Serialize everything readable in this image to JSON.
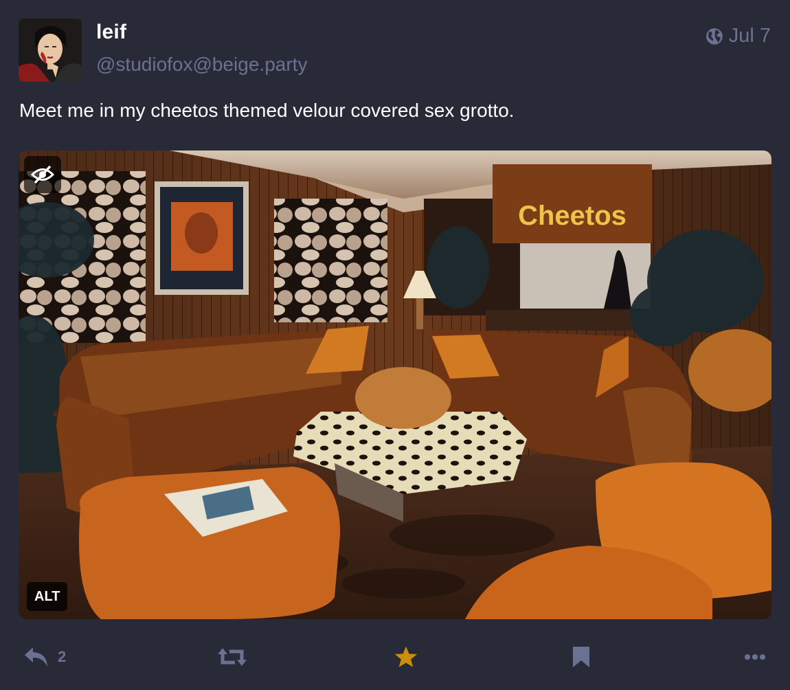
{
  "author": {
    "display_name": "leif",
    "handle": "@studiofox@beige.party"
  },
  "post": {
    "timestamp": "Jul 7",
    "visibility_icon": "globe-icon",
    "text": "Meet me in my cheetos themed velour covered sex grotto."
  },
  "media": {
    "sign_text": "Cheetos",
    "alt_label": "ALT",
    "hide_icon": "eye-slash-icon"
  },
  "actions": {
    "reply_count": "2",
    "reply_icon": "reply-icon",
    "boost_icon": "boost-icon",
    "favourite_icon": "star-icon",
    "favourite_active": true,
    "bookmark_icon": "bookmark-icon",
    "more_icon": "ellipsis-icon"
  },
  "colors": {
    "background": "#282a37",
    "muted_text": "#6b7191",
    "favourite_active": "#ca8f04",
    "text": "#ffffff"
  }
}
